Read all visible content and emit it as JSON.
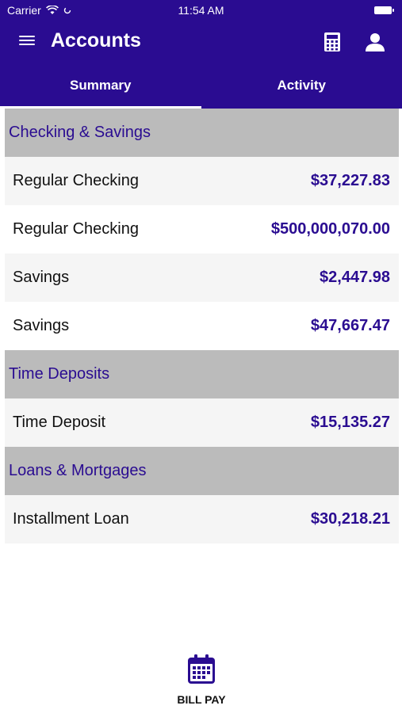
{
  "status_bar": {
    "carrier": "Carrier",
    "time": "11:54 AM",
    "wifi_icon": "wifi-icon",
    "battery_icon": "battery-icon"
  },
  "header": {
    "title": "Accounts",
    "menu_icon": "hamburger-menu-icon",
    "calculator_icon": "calculator-icon",
    "user_icon": "user-icon"
  },
  "tabs": [
    {
      "label": "Summary",
      "active": true
    },
    {
      "label": "Activity",
      "active": false
    }
  ],
  "sections": [
    {
      "title": "Checking & Savings",
      "accounts": [
        {
          "name": "Regular Checking",
          "balance": "$37,227.83"
        },
        {
          "name": "Regular Checking",
          "balance": "$500,000,070.00"
        },
        {
          "name": "Savings",
          "balance": "$2,447.98"
        },
        {
          "name": "Savings",
          "balance": "$47,667.47"
        }
      ]
    },
    {
      "title": "Time Deposits",
      "accounts": [
        {
          "name": "Time Deposit",
          "balance": "$15,135.27"
        }
      ]
    },
    {
      "title": "Loans & Mortgages",
      "accounts": [
        {
          "name": "Installment Loan",
          "balance": "$30,218.21"
        }
      ]
    }
  ],
  "bottom_action": {
    "label": "BILL PAY",
    "icon": "calendar-icon"
  },
  "colors": {
    "brand": "#2a0c91",
    "section_bg": "#bbbbbb",
    "row_alt_bg": "#f5f5f5"
  }
}
